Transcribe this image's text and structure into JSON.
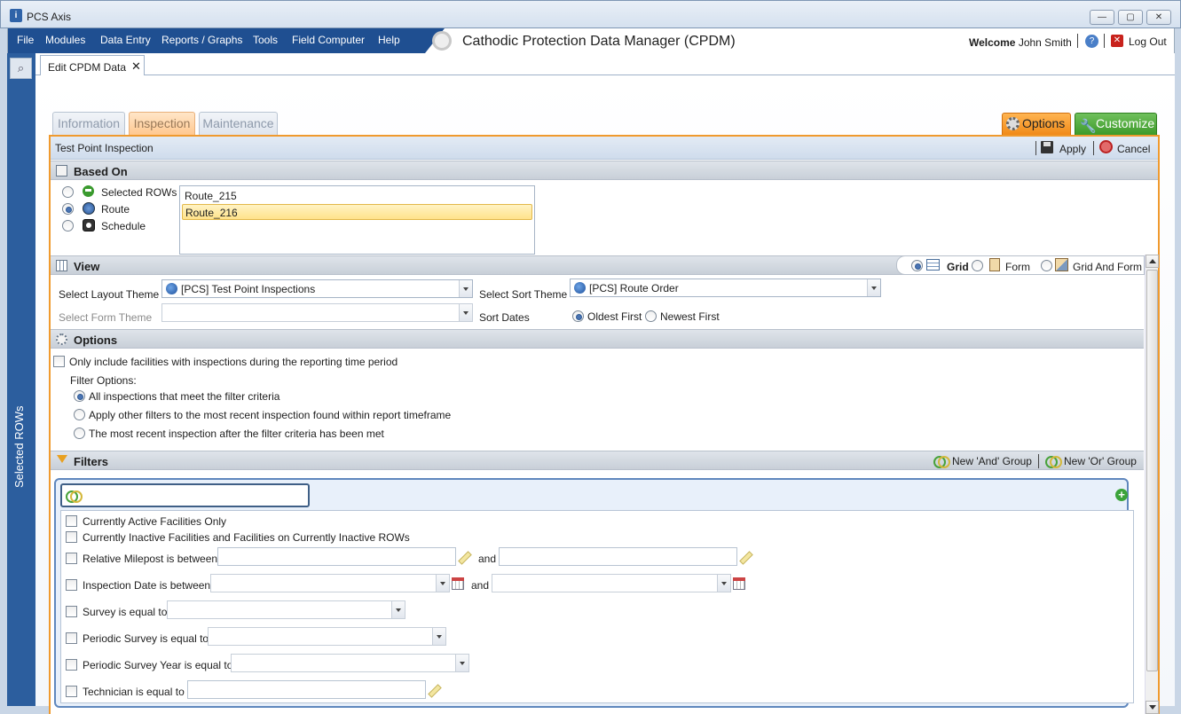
{
  "window": {
    "title": "PCS Axis",
    "min": "—",
    "max": "▢",
    "close": "✕"
  },
  "menu": {
    "items": [
      "File",
      "Modules",
      "Data Entry",
      "Reports / Graphs",
      "Tools",
      "Field Computer",
      "Help"
    ]
  },
  "header": {
    "app_title": "Cathodic Protection Data Manager (CPDM)",
    "welcome_label": "Welcome",
    "user": "John Smith",
    "logout": "Log Out"
  },
  "sidebar": {
    "label": "Selected ROWs"
  },
  "doc_tab": {
    "label": "Edit CPDM Data",
    "close": "✕"
  },
  "section_tabs": [
    "Information",
    "Inspection",
    "Maintenance"
  ],
  "right_tabs": {
    "options": "Options",
    "customize": "Customize"
  },
  "panel": {
    "title": "Test Point Inspection",
    "apply": "Apply",
    "cancel": "Cancel"
  },
  "based_on": {
    "title": "Based On",
    "options": [
      "Selected ROWs",
      "Route",
      "Schedule"
    ],
    "selected": "Route",
    "routes": [
      "Route_215",
      "Route_216"
    ],
    "selected_route": "Route_216"
  },
  "view": {
    "title": "View",
    "modes": [
      "Grid",
      "Form",
      "Grid And Form"
    ],
    "selected_mode": "Grid",
    "layout_theme_label": "Select Layout Theme",
    "layout_theme_value": "[PCS] Test Point Inspections",
    "form_theme_label": "Select Form Theme",
    "sort_theme_label": "Select Sort Theme",
    "sort_theme_value": "[PCS] Route Order",
    "sort_dates_label": "Sort Dates",
    "sort_options": [
      "Oldest First",
      "Newest First"
    ],
    "sort_selected": "Oldest First"
  },
  "options": {
    "title": "Options",
    "only_include": "Only include facilities with inspections during the reporting time period",
    "filter_options_label": "Filter Options:",
    "filter_options": [
      "All inspections that meet the filter criteria",
      "Apply other filters to the most recent inspection found within report timeframe",
      "The most recent inspection after the filter criteria has been met"
    ],
    "filter_selected": "All inspections that meet the filter criteria"
  },
  "filters": {
    "title": "Filters",
    "new_and": "New 'And' Group",
    "new_or": "New 'Or' Group",
    "rows": [
      {
        "label": "Currently Active Facilities Only"
      },
      {
        "label": "Currently Inactive Facilities and Facilities on Currently Inactive ROWs"
      },
      {
        "label": "Relative Milepost is between",
        "and": "and"
      },
      {
        "label": "Inspection Date is between",
        "and": "and"
      },
      {
        "label": "Survey is equal to"
      },
      {
        "label": "Periodic Survey is equal to"
      },
      {
        "label": "Periodic Survey Year is equal to"
      },
      {
        "label": "Technician is equal to"
      }
    ]
  },
  "colors": {
    "menu_blue": "#1f4f91",
    "panel_border": "#f09a2e",
    "options_tab": "#f08a18",
    "customize_tab": "#3d9a2a"
  }
}
